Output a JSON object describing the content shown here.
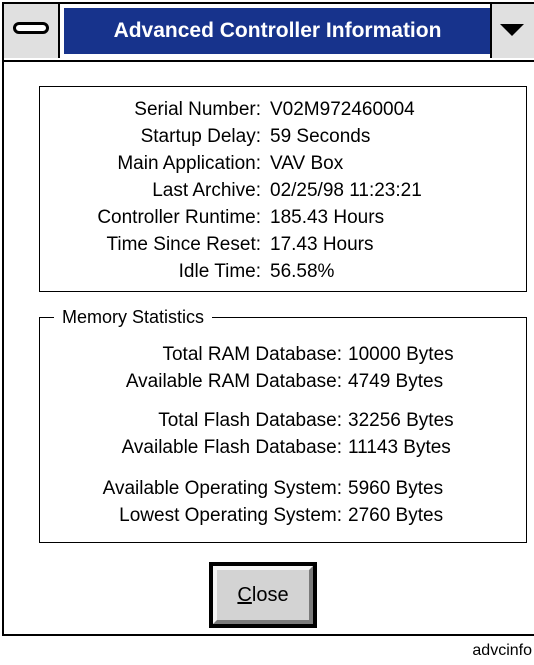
{
  "window": {
    "title": "Advanced Controller Information"
  },
  "info": {
    "rows": [
      {
        "label": "Serial Number:",
        "value": "V02M972460004"
      },
      {
        "label": "Startup Delay:",
        "value": "59 Seconds"
      },
      {
        "label": "Main Application:",
        "value": "VAV Box"
      },
      {
        "label": "Last Archive:",
        "value": "02/25/98 11:23:21"
      },
      {
        "label": "Controller Runtime:",
        "value": "185.43 Hours"
      },
      {
        "label": "Time Since Reset:",
        "value": "17.43 Hours"
      },
      {
        "label": "Idle Time:",
        "value": "56.58%"
      }
    ]
  },
  "memory": {
    "legend": "Memory Statistics",
    "rows": [
      {
        "label": "Total RAM Database:",
        "value": "10000 Bytes"
      },
      {
        "label": "Available RAM Database:",
        "value": "4749 Bytes"
      },
      {
        "label": "Total Flash Database:",
        "value": "32256 Bytes"
      },
      {
        "label": "Available Flash Database:",
        "value": "11143 Bytes"
      },
      {
        "label": "Available Operating System:",
        "value": "5960 Bytes"
      },
      {
        "label": "Lowest Operating System:",
        "value": "2760 Bytes"
      }
    ]
  },
  "buttons": {
    "close_mnemonic": "C",
    "close_rest": "lose"
  },
  "footer": {
    "caption": "advcinfo"
  },
  "colors": {
    "titlebar": "#17338c",
    "button_face": "#d3d3d3"
  },
  "icons": {
    "system_menu": "system-menu-icon",
    "dropdown": "chevron-down-icon"
  }
}
